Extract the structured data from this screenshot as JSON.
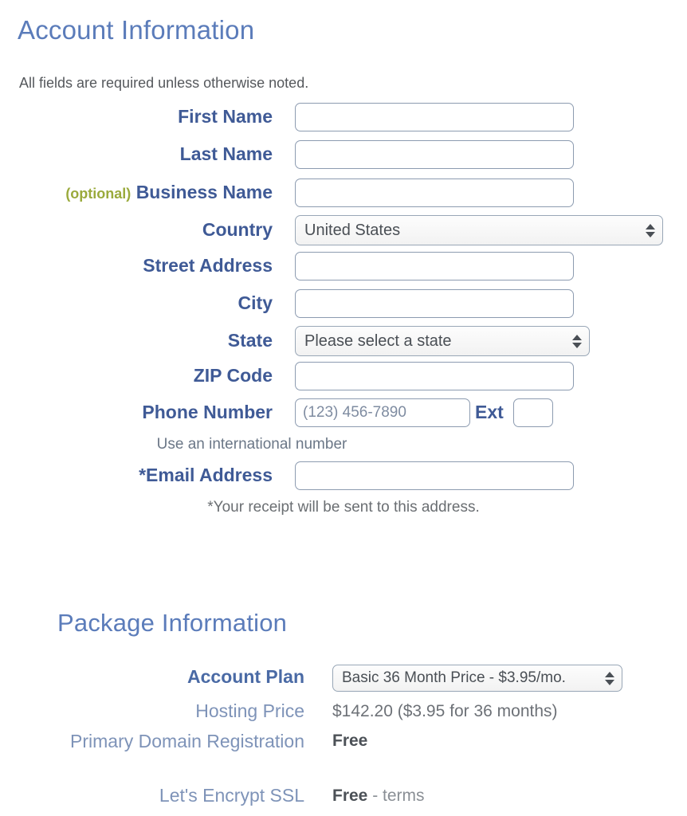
{
  "account": {
    "title": "Account Information",
    "required_note": "All fields are required unless otherwise noted.",
    "fields": {
      "first_name": {
        "label": "First Name",
        "value": "",
        "placeholder": ""
      },
      "last_name": {
        "label": "Last Name",
        "value": "",
        "placeholder": ""
      },
      "business_name": {
        "label": "Business Name",
        "optional_tag": "(optional)",
        "value": "",
        "placeholder": ""
      },
      "country": {
        "label": "Country",
        "selected": "United States"
      },
      "street_address": {
        "label": "Street Address",
        "value": "",
        "placeholder": ""
      },
      "city": {
        "label": "City",
        "value": "",
        "placeholder": ""
      },
      "state": {
        "label": "State",
        "selected": "Please select a state"
      },
      "zip_code": {
        "label": "ZIP Code",
        "value": "",
        "placeholder": ""
      },
      "phone": {
        "label": "Phone Number",
        "value": "",
        "placeholder": "(123) 456-7890"
      },
      "ext": {
        "label": "Ext",
        "value": "",
        "placeholder": ""
      },
      "email": {
        "label": "*Email Address",
        "value": "",
        "placeholder": ""
      }
    },
    "notes": {
      "international": "Use an international number",
      "receipt": "*Your receipt will be sent to this address."
    }
  },
  "package": {
    "title": "Package Information",
    "rows": [
      {
        "label": "Account Plan",
        "selected": "Basic 36 Month Price - $3.95/mo."
      },
      {
        "label": "Hosting Price",
        "value": "$142.20  ($3.95 for 36 months)"
      },
      {
        "label": "Primary Domain Registration",
        "value": "Free"
      },
      {
        "label": "Let's Encrypt SSL",
        "value": "Free",
        "suffix": " - ",
        "link": "terms"
      }
    ]
  },
  "colors": {
    "heading": "#5b7cba",
    "label": "#3f5a96",
    "optional": "#9aaa3c",
    "input_border": "#8c9bb0",
    "muted_label": "#7e93b8",
    "value_text": "#6d7177"
  }
}
